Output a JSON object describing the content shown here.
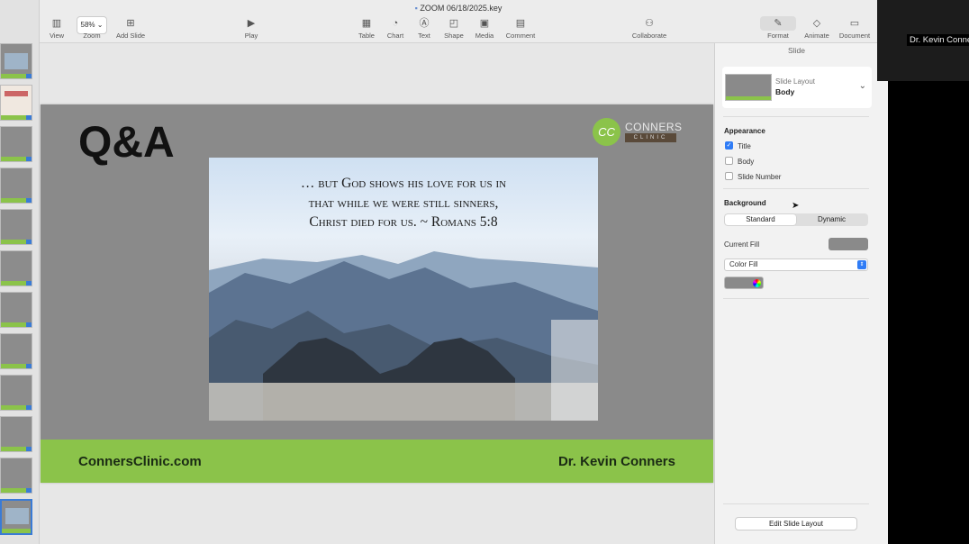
{
  "window": {
    "title": "ZOOM 06/18/2025.key"
  },
  "toolbar": {
    "view": "View",
    "zoom_value": "58%",
    "zoom": "Zoom",
    "add_slide": "Add Slide",
    "play": "Play",
    "table": "Table",
    "chart": "Chart",
    "text": "Text",
    "shape": "Shape",
    "media": "Media",
    "comment": "Comment",
    "collaborate": "Collaborate",
    "format": "Format",
    "animate": "Animate",
    "document": "Document"
  },
  "slide": {
    "title": "Q&A",
    "logo_line1": "CONNERS",
    "logo_line2": "CLINIC",
    "logo_initials": "CC",
    "quote_line1": "… but God shows his love for us in",
    "quote_line2": "that while we were still sinners,",
    "quote_line3": "Christ died for us.   ~ Romans 5:8",
    "footer_left": "ConnersClinic.com",
    "footer_right": "Dr. Kevin Conners"
  },
  "inspector": {
    "header": "Slide",
    "layout_label": "Slide Layout",
    "layout_value": "Body",
    "appearance": "Appearance",
    "title_cb": "Title",
    "body_cb": "Body",
    "slide_number_cb": "Slide Number",
    "background": "Background",
    "standard": "Standard",
    "dynamic": "Dynamic",
    "current_fill": "Current Fill",
    "fill_type": "Color Fill",
    "edit_layout": "Edit Slide Layout",
    "title_checked": true,
    "body_checked": false,
    "slide_number_checked": false
  },
  "zoom_participant": "Dr. Kevin Conners",
  "colors": {
    "accent_green": "#8bc34a",
    "slide_gray": "#8a8a8a",
    "checkbox_blue": "#2f7cf6"
  }
}
